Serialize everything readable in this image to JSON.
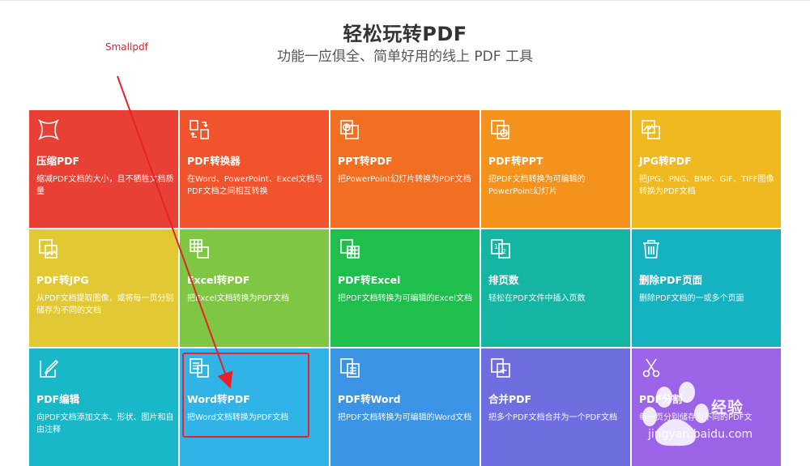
{
  "header": {
    "title": "轻松玩转PDF",
    "subtitle": "功能一应俱全、简单好用的线上 PDF 工具"
  },
  "annotation": {
    "label": "Smallpdf",
    "color": "#e8202a"
  },
  "tiles": [
    {
      "icon": "compress-icon",
      "title": "压缩PDF",
      "desc": "缩减PDF文档的大小，且不牺牲文档质量",
      "color": "#e94036"
    },
    {
      "icon": "convert-icon",
      "title": "PDF转换器",
      "desc": "在Word、PowerPoint、Excel文档与PDF文档之间相互转换",
      "color": "#f1542c"
    },
    {
      "icon": "ppt-to-pdf-icon",
      "title": "PPT转PDF",
      "desc": "把PowerPoint幻灯片转换为PDF文档",
      "color": "#f26f22"
    },
    {
      "icon": "pdf-to-ppt-icon",
      "title": "PDF转PPT",
      "desc": "把PDF文档转换为可编辑的PowerPoint幻灯片",
      "color": "#f5921c"
    },
    {
      "icon": "jpg-to-pdf-icon",
      "title": "JPG转PDF",
      "desc": "把JPG、PNG、BMP、GIF、TIFF图像转换为PDF文档",
      "color": "#f1b920"
    },
    {
      "icon": "pdf-to-jpg-icon",
      "title": "PDF转JPG",
      "desc": "从PDF文档提取图像，或将每一页分别储存为不同的文档",
      "color": "#e2c934"
    },
    {
      "icon": "excel-to-pdf-icon",
      "title": "Excel转PDF",
      "desc": "把Excel文档转换为PDF文档",
      "color": "#7fc742"
    },
    {
      "icon": "pdf-to-excel-icon",
      "title": "PDF转Excel",
      "desc": "把PDF文档转换为可编辑的Excel文档",
      "color": "#1fbf4e"
    },
    {
      "icon": "page-number-icon",
      "title": "排页数",
      "desc": "轻松在PDF文件中插入页数",
      "color": "#14b6a3"
    },
    {
      "icon": "trash-icon",
      "title": "删除PDF页面",
      "desc": "删除PDF文档的一或多个页面",
      "color": "#15b3c1"
    },
    {
      "icon": "edit-icon",
      "title": "PDF编辑",
      "desc": "向PDF文档添加文本、形状、图片和自由注释",
      "color": "#19b8c9"
    },
    {
      "icon": "word-to-pdf-icon",
      "title": "Word转PDF",
      "desc": "把Word文档转换为PDF文档",
      "color": "#30b4e8"
    },
    {
      "icon": "pdf-to-word-icon",
      "title": "PDF转Word",
      "desc": "把PDF文档转换为可编辑的Word文档",
      "color": "#3b93e6"
    },
    {
      "icon": "merge-icon",
      "title": "合并PDF",
      "desc": "把多个PDF文档合并为一个PDF文档",
      "color": "#6f6ee0"
    },
    {
      "icon": "split-icon",
      "title": "PDF分割",
      "desc": "每一页分别储存为不同的PDF文",
      "color": "#9a63e8"
    }
  ],
  "watermark": {
    "text": "经验",
    "url": "jingyan.baidu.com"
  }
}
